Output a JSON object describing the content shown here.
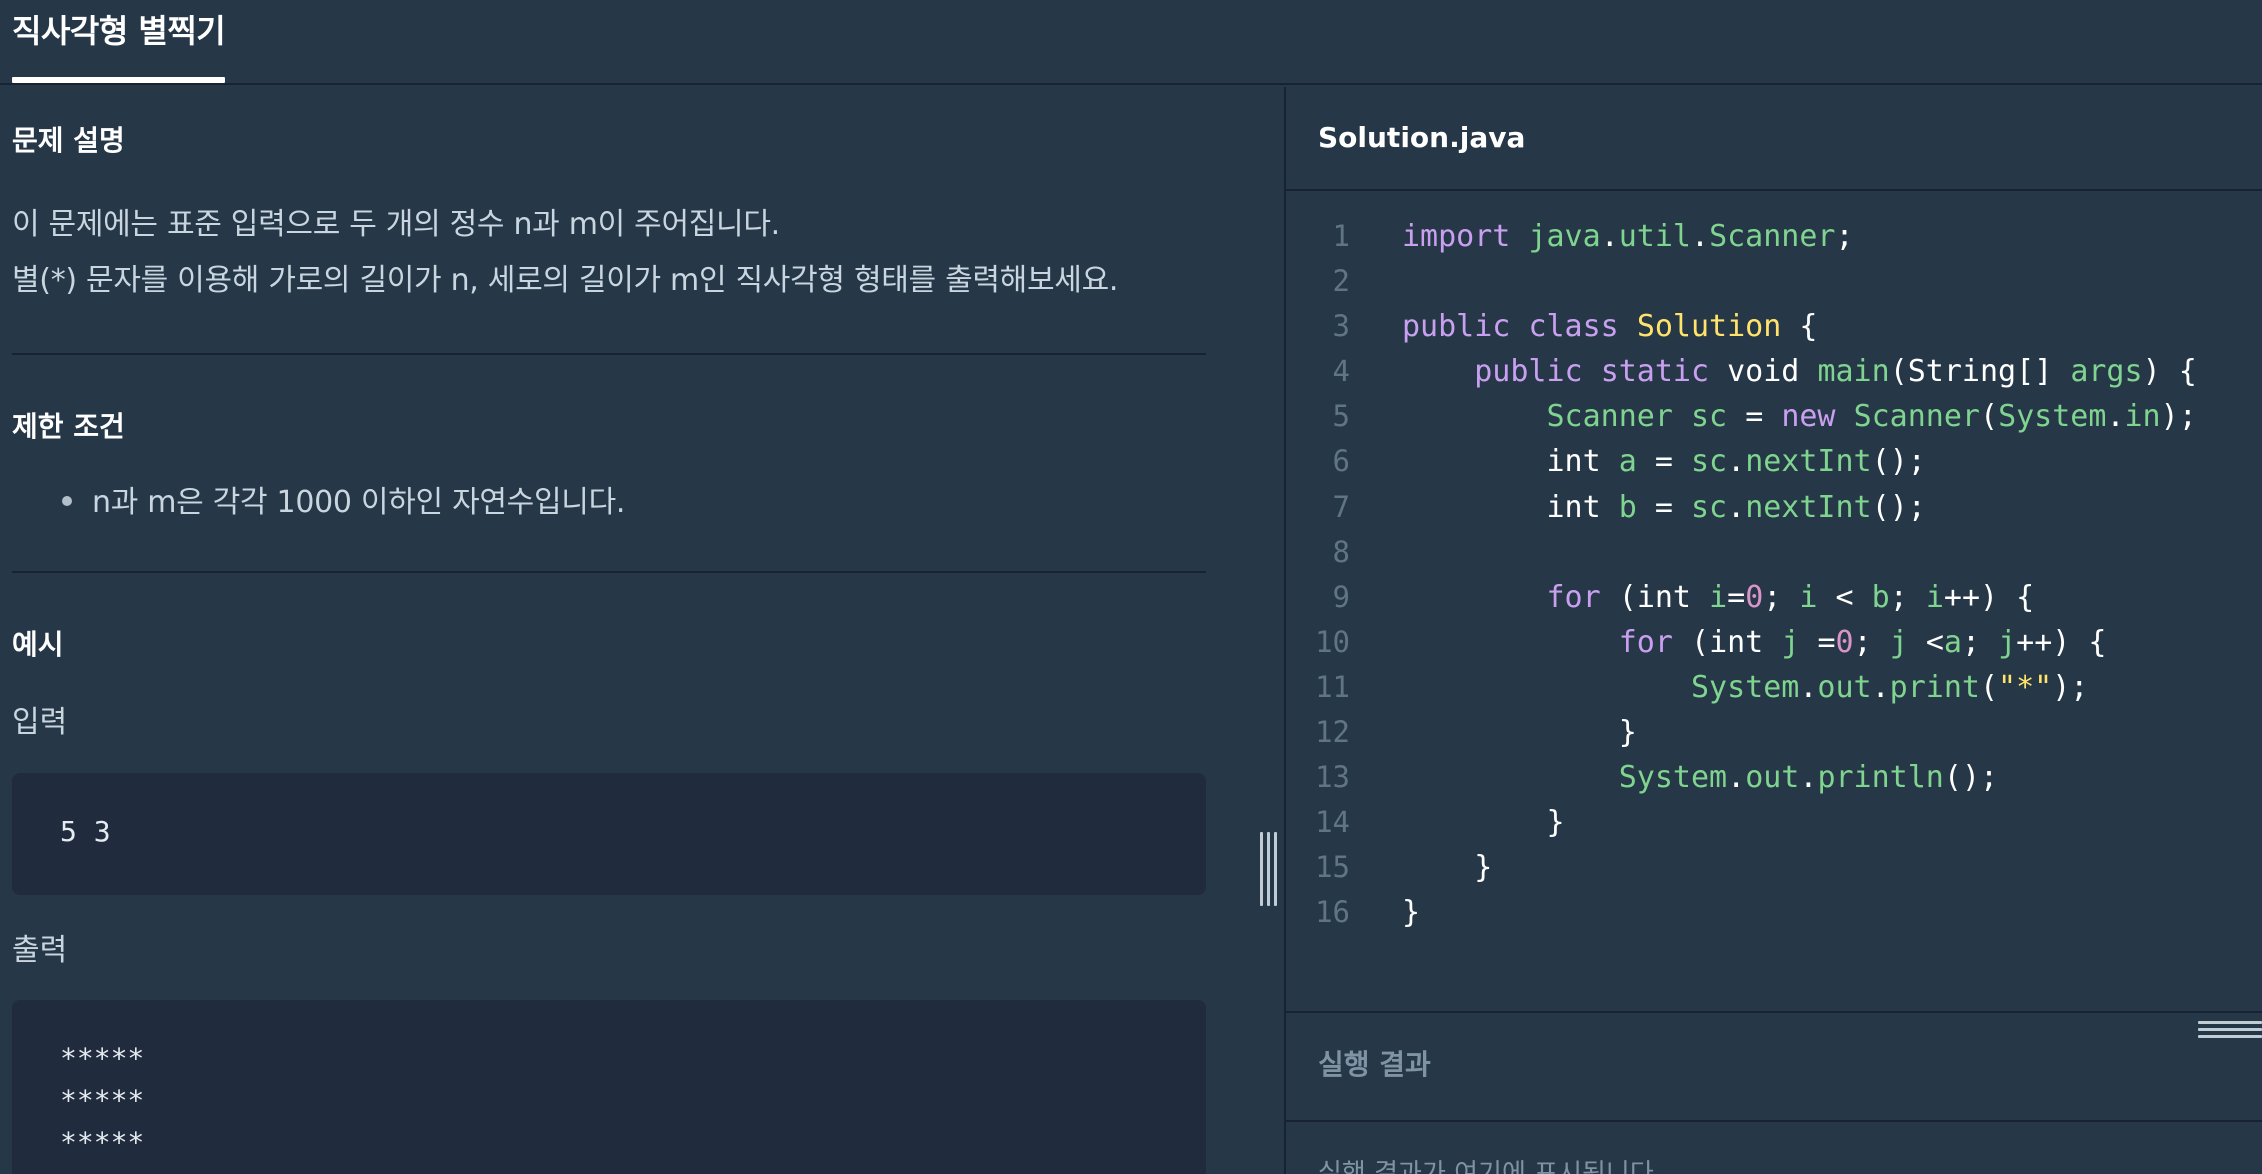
{
  "header": {
    "tab_title": "직사각형 별찍기"
  },
  "problem": {
    "description_title": "문제 설명",
    "description_lines": [
      "이 문제에는 표준 입력으로 두 개의 정수 n과 m이 주어집니다.",
      "별(*) 문자를 이용해 가로의 길이가 n, 세로의 길이가 m인 직사각형 형태를 출력해보세요."
    ],
    "constraints_title": "제한 조건",
    "constraints": [
      "n과 m은 각각 1000 이하인 자연수입니다."
    ],
    "example_title": "예시",
    "input_label": "입력",
    "input_value": "5 3",
    "output_label": "출력",
    "output_lines": [
      "*****",
      "*****",
      "*****"
    ]
  },
  "editor": {
    "file_name": "Solution.java",
    "line_numbers": [
      "1",
      "2",
      "3",
      "4",
      "5",
      "6",
      "7",
      "8",
      "9",
      "10",
      "11",
      "12",
      "13",
      "14",
      "15",
      "16"
    ],
    "code_lines": [
      "import java.util.Scanner;",
      "",
      "public class Solution {",
      "    public static void main(String[] args) {",
      "        Scanner sc = new Scanner(System.in);",
      "        int a = sc.nextInt();",
      "        int b = sc.nextInt();",
      "",
      "        for (int i=0; i < b; i++) {",
      "            for (int j =0; j <a; j++) {",
      "                System.out.print(\"*\");",
      "            }",
      "            System.out.println();",
      "        }",
      "    }",
      "}"
    ]
  },
  "result": {
    "title": "실행 결과",
    "placeholder": "실행 결과가 여기에 표시됩니다."
  },
  "colors": {
    "background": "#263747",
    "code_box": "#202b3d",
    "keyword": "#c9a0f0",
    "type": "#ffe36a",
    "identifier": "#7fd48f",
    "number": "#d895c8"
  }
}
